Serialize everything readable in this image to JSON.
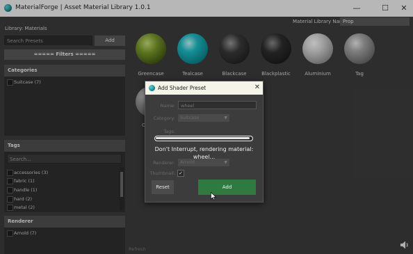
{
  "window": {
    "title": "MaterialForge | Asset Material Library 1.0.1",
    "controls": {
      "minimize": "—",
      "maximize": "☐",
      "close": "✕"
    }
  },
  "left_panel": {
    "library_label": "Library: Materials",
    "search_placeholder": "Search Presets",
    "add_button": "Add",
    "filters_label": "===== Filters =====",
    "categories": {
      "header": "Categories",
      "items": [
        {
          "label": "Suitcase (7)",
          "checked": false
        }
      ]
    },
    "tags": {
      "header": "Tags",
      "search_placeholder": "Search...",
      "items": [
        {
          "label": "accessories (3)",
          "checked": false
        },
        {
          "label": "fabric (1)",
          "checked": false
        },
        {
          "label": "handle (1)",
          "checked": false
        },
        {
          "label": "hard (2)",
          "checked": false
        },
        {
          "label": "metal (2)",
          "checked": false
        }
      ]
    },
    "renderer": {
      "header": "Renderer",
      "items": [
        {
          "label": "Arnold (7)",
          "checked": false
        }
      ]
    }
  },
  "main": {
    "material_library_label": "Material Library Name:",
    "material_library_value": "Prop",
    "materials": [
      {
        "label": "Greencase",
        "color": "#7a9a2a"
      },
      {
        "label": "Tealcase",
        "color": "#1cc0c8"
      },
      {
        "label": "Blackcase",
        "color": "#3a3a3a"
      },
      {
        "label": "Blackplastic",
        "color": "#2e2e2e"
      },
      {
        "label": "Aluminium",
        "color": "#d8d8d8"
      },
      {
        "label": "Tag",
        "color": "#a8a8a8"
      }
    ],
    "second_row_partial_label": "C",
    "refresh_label": "Refresh"
  },
  "dialog": {
    "title": "Add Shader Preset",
    "close": "✕",
    "name_label": "Name:",
    "name_value": "wheel",
    "category_label": "Category:",
    "category_value": "Suitcase",
    "tags_label": "Tags:",
    "progress_fraction": 0.98,
    "render_message": "Don't Interrupt, rendering material: wheel...",
    "renderer_label": "Renderer:",
    "renderer_value": "Arnold",
    "thumbnail_label": "Thumbnail:",
    "thumbnail_checked": "✓",
    "reset_button": "Reset",
    "add_button": "Add"
  },
  "colors": {
    "accent_green": "#2f7a3f",
    "teal_icon": "#1cc0c8"
  }
}
